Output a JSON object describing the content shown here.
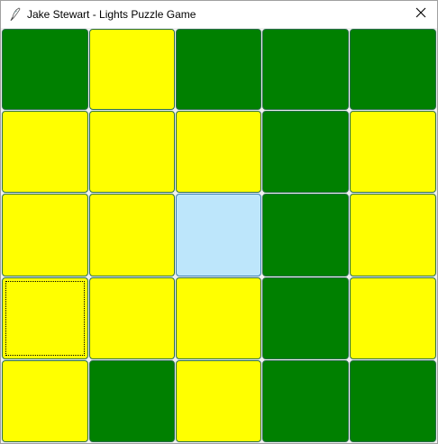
{
  "window": {
    "title": "Jake Stewart - Lights Puzzle Game",
    "icon": "feather-pen-icon",
    "close_icon": "close-icon"
  },
  "colors": {
    "on": "#ffff00",
    "off": "#008000",
    "selected": "#bde6fb"
  },
  "board": {
    "rows": [
      [
        "off",
        "on",
        "off",
        "off",
        "off"
      ],
      [
        "on",
        "on",
        "on",
        "off",
        "on"
      ],
      [
        "on",
        "on",
        "selected",
        "off",
        "on"
      ],
      [
        "on",
        "on",
        "on",
        "off",
        "on"
      ],
      [
        "on",
        "off",
        "on",
        "off",
        "off"
      ]
    ],
    "focused_cell": [
      3,
      0
    ]
  }
}
